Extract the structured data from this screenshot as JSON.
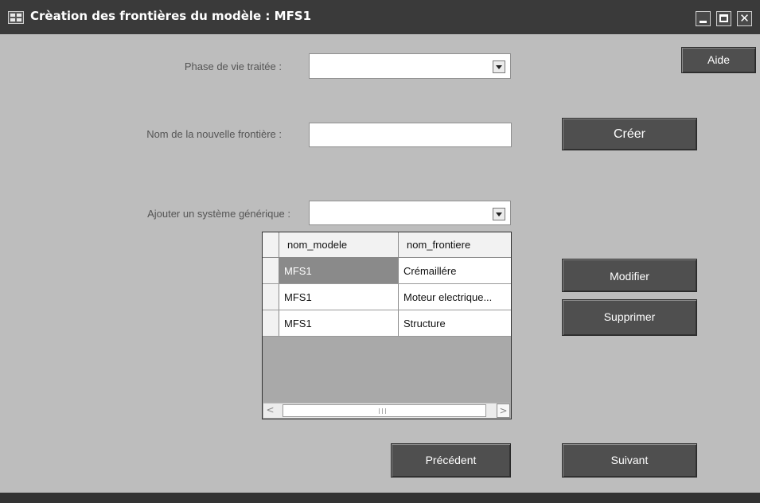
{
  "window": {
    "title": "Crèation des frontières du modèle : MFS1",
    "controls": {
      "minimize": "minimize-icon",
      "maximize": "maximize-icon",
      "close": "✕"
    }
  },
  "form": {
    "phase_label": "Phase de vie traitée :",
    "phase_value": "",
    "nom_label": "Nom de la nouvelle frontière :",
    "nom_value": "",
    "ajout_label": "Ajouter un système générique :",
    "ajout_value": ""
  },
  "buttons": {
    "aide": "Aide",
    "creer": "Créer",
    "modifier": "Modifier",
    "supprimer": "Supprimer",
    "precedent": "Précédent",
    "suivant": "Suivant"
  },
  "grid": {
    "columns": [
      "nom_modele",
      "nom_frontiere"
    ],
    "rows": [
      [
        "MFS1",
        "Crémaillére"
      ],
      [
        "MFS1",
        "Moteur electrique..."
      ],
      [
        "MFS1",
        "Structure"
      ]
    ],
    "selected_cell": "row 1, nom_modele"
  },
  "scrollbar": {
    "left_arrow": "<",
    "right_arrow": ">"
  },
  "colors": {
    "titlebar": "#3a3a3a",
    "background": "#bdbdbd",
    "button": "#4f4f4f",
    "selection": "#8a8a8a"
  }
}
